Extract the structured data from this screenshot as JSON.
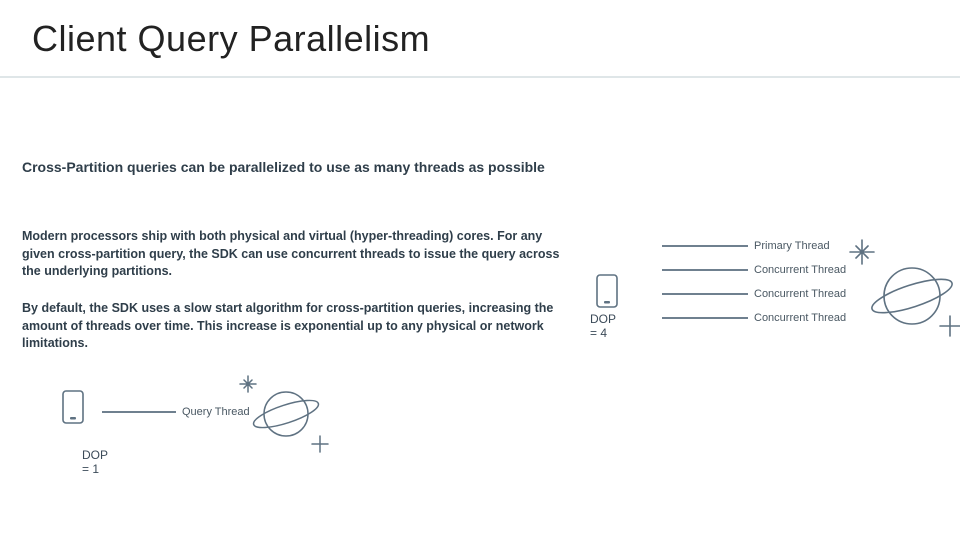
{
  "title": "Client Query Parallelism",
  "subhead": "Cross-Partition queries can be parallelized to use as many threads as possible",
  "para1": "Modern processors ship with both physical and virtual (hyper-threading) cores. For any given cross-partition query, the SDK can use concurrent threads to issue the query across the underlying partitions.",
  "para2": "By default, the SDK uses a slow start algorithm for cross-partition queries, increasing the amount of threads over time. This increase is exponential up to any physical or network limitations.",
  "dop1": {
    "label": "DOP = 1",
    "thread": "Query Thread"
  },
  "dop4": {
    "label": "DOP = 4",
    "threads": [
      "Primary Thread",
      "Concurrent Thread",
      "Concurrent Thread",
      "Concurrent Thread"
    ]
  },
  "colors": {
    "stroke": "#5f7282"
  }
}
